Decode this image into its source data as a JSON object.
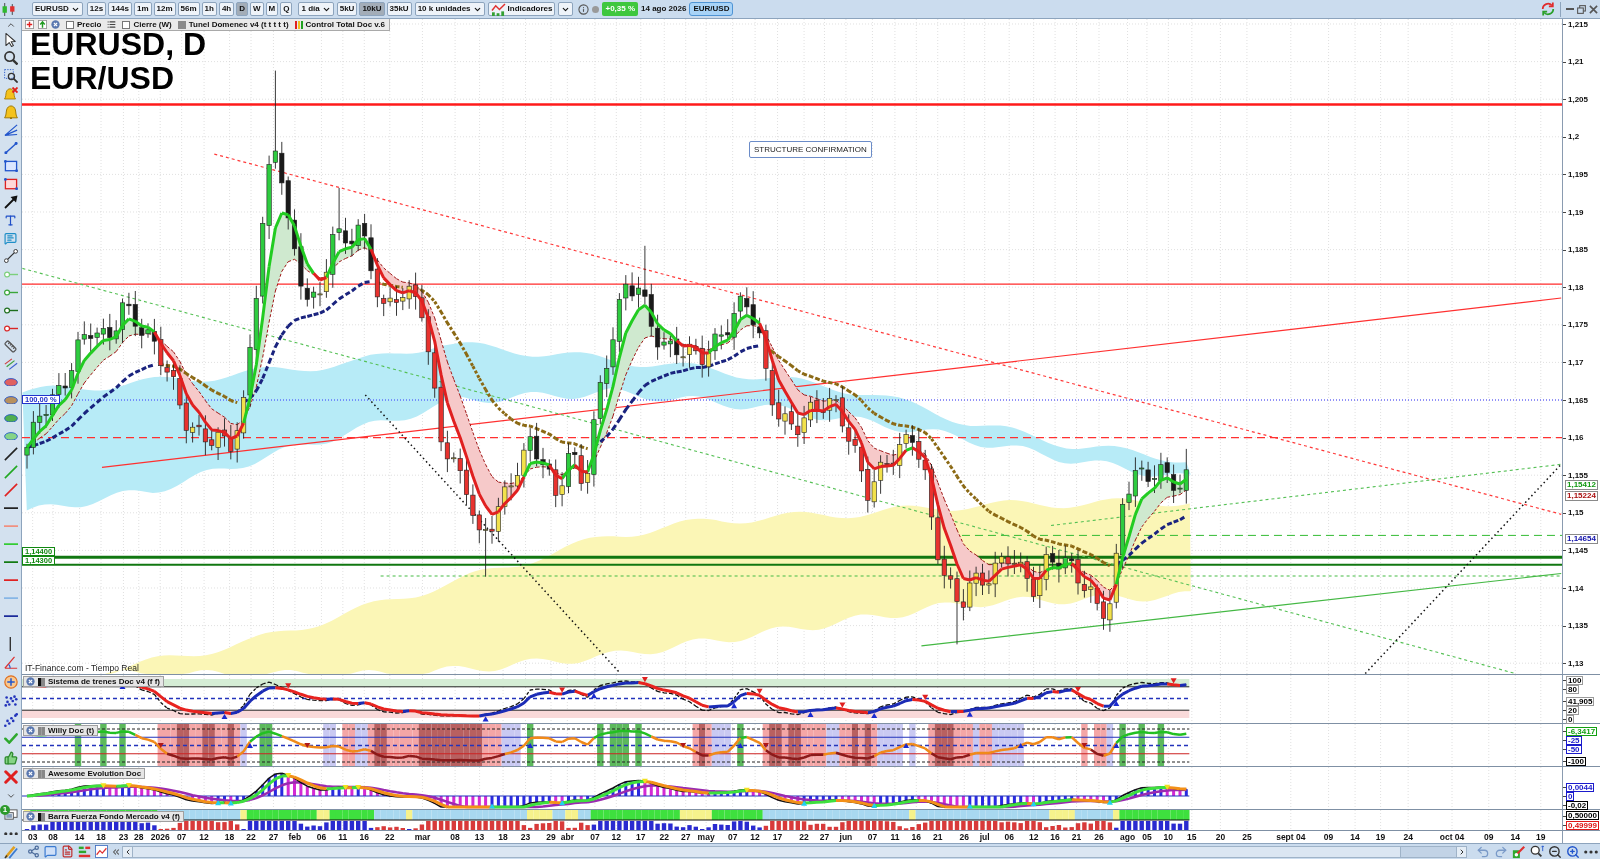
{
  "toolbar": {
    "symbol": "EURUSD",
    "timeframes": [
      {
        "label": "12s",
        "selected": false
      },
      {
        "label": "144s",
        "selected": false
      },
      {
        "label": "1m",
        "selected": false
      },
      {
        "label": "12m",
        "selected": false
      },
      {
        "label": "56m",
        "selected": false
      },
      {
        "label": "1h",
        "selected": false
      },
      {
        "label": "4h",
        "selected": false
      },
      {
        "label": "D",
        "selected": true
      },
      {
        "label": "W",
        "selected": false
      },
      {
        "label": "M",
        "selected": false
      },
      {
        "label": "Q",
        "selected": false
      }
    ],
    "period": "1 día",
    "unit_presets": [
      {
        "label": "5kU",
        "selected": false
      },
      {
        "label": "10kU",
        "selected": true
      },
      {
        "label": "35kU",
        "selected": false
      }
    ],
    "units": "10 k unidades",
    "indicators": "Indicadores",
    "change": "+0,35 %",
    "date": "14 ago 2026",
    "instrument": "EUR/USD"
  },
  "left_toolbar": {
    "badge": "1"
  },
  "legend": [
    {
      "kind": "checkbox",
      "label": "Precio",
      "checked": false
    },
    {
      "kind": "checkbox",
      "label": "Cierre (W)",
      "checked": false
    },
    {
      "kind": "indicator",
      "label": "Tunel Domenec v4 (t t t t t)"
    },
    {
      "kind": "system",
      "label": "Control Total Doc v.6"
    }
  ],
  "chart": {
    "title": "EURUSD, D",
    "subtitle": "EUR/USD",
    "annotation": "STRUCTURE CONFIRMATION",
    "level_tags": [
      {
        "label": "100,00 %",
        "color": "#2233cc"
      },
      {
        "label": "1,14400",
        "color": "#118811"
      },
      {
        "label": "1,14300",
        "color": "#118811"
      }
    ],
    "source": "IT-Finance.com - Tiempo Real"
  },
  "price_axis": {
    "ticks": [
      "1,215",
      "1,21",
      "1,205",
      "1,2",
      "1,195",
      "1,19",
      "1,185",
      "1,18",
      "1,175",
      "1,17",
      "1,165",
      "1,16",
      "1,155",
      "1,15",
      "1,145",
      "1,14",
      "1,135",
      "1,13"
    ],
    "markers": [
      {
        "label": "1,15412",
        "color": "#119911"
      },
      {
        "label": "1,15224",
        "color": "#aa1111"
      },
      {
        "label": "1,14654",
        "color": "#1111aa"
      }
    ]
  },
  "panels": [
    {
      "kind": "trains",
      "title": "Sistema de trenes Doc v4 (f f)",
      "axis": [
        {
          "label": "100"
        },
        {
          "label": "80"
        },
        {
          "label": "41,905"
        },
        {
          "label": "20"
        },
        {
          "label": "0"
        }
      ]
    },
    {
      "kind": "williams",
      "title": "Willy Doc (t)",
      "axis": [
        {
          "label": "-6,3417",
          "color": "#12a012"
        },
        {
          "label": "-25",
          "color": "#1a1acc"
        },
        {
          "label": "-50",
          "color": "#1a1acc"
        },
        {
          "label": "-100",
          "color": "#000000"
        }
      ]
    },
    {
      "kind": "awesome",
      "title": "Awesome Evolution Doc",
      "axis": [
        {
          "label": "0,0044",
          "color": "#1a1acc"
        },
        {
          "label": "0",
          "color": "#1a1acc"
        },
        {
          "label": "-0,02",
          "color": "#000000"
        }
      ]
    },
    {
      "kind": "strength",
      "title": "Barra Fuerza Fondo Mercado v4 (f)",
      "axis": [
        {
          "label": "0,50000",
          "color": "#000000"
        },
        {
          "label": "0,49999",
          "color": "#e01818"
        }
      ]
    }
  ],
  "date_axis": [
    "03",
    "08",
    "14",
    "18",
    "23",
    "28",
    "2026",
    "07",
    "12",
    "18",
    "22",
    "27",
    "feb",
    "06",
    "11",
    "16",
    "22",
    "mar",
    "08",
    "13",
    "18",
    "23",
    "29",
    "abr",
    "07",
    "12",
    "17",
    "22",
    "27",
    "may",
    "07",
    "12",
    "17",
    "22",
    "27",
    "jun",
    "07",
    "11",
    "16",
    "21",
    "26",
    "jul",
    "06",
    "12",
    "16",
    "21",
    "26",
    "ago",
    "05",
    "10",
    "15",
    "20",
    "25",
    "sept 04",
    "09",
    "14",
    "19",
    "24",
    "oct 04",
    "09",
    "14",
    "19"
  ]
}
